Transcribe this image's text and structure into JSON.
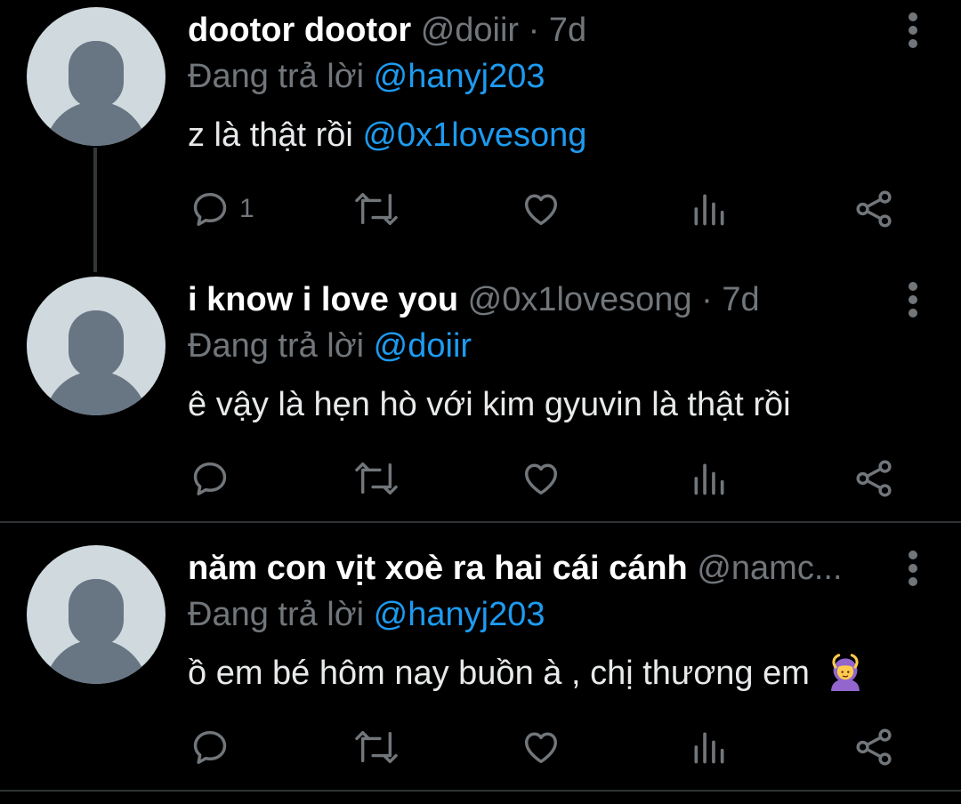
{
  "tweets": [
    {
      "name": "dootor dootor",
      "handle": "@doiir",
      "separator": "·",
      "time": "7d",
      "replying_prefix": "Đang trả lời",
      "replying_to": "@hanyj203",
      "text": "z là thật rồi",
      "text_mention": "@0x1lovesong",
      "reply_count": "1"
    },
    {
      "name": "i know i love you",
      "handle": "@0x1lovesong",
      "separator": "·",
      "time": "7d",
      "replying_prefix": "Đang trả lời",
      "replying_to": "@doiir",
      "text": "ê vậy là hẹn hò với kim gyuvin là thật rồi",
      "text_mention": "",
      "reply_count": ""
    },
    {
      "name": "năm con vịt xoè ra hai cái cánh",
      "handle": "@namc...",
      "separator": "",
      "time": "",
      "replying_prefix": "Đang trả lời",
      "replying_to": "@hanyj203",
      "text": "ồ em bé hôm nay buồn à , chị thương em",
      "text_mention": "",
      "reply_count": ""
    }
  ],
  "icons": {
    "reply": "reply-icon",
    "retweet": "retweet-icon",
    "like": "heart-icon",
    "views": "views-icon",
    "share": "share-icon",
    "more": "more-vertical-icon",
    "emoji": "person-gesturing-ok-emoji"
  },
  "colors": {
    "background": "#000000",
    "text": "#e7e9ea",
    "secondary": "#71767b",
    "link": "#1d9bf0",
    "avatar_bg": "#cfd9de",
    "avatar_fg": "#687684",
    "divider": "#2f3336"
  }
}
